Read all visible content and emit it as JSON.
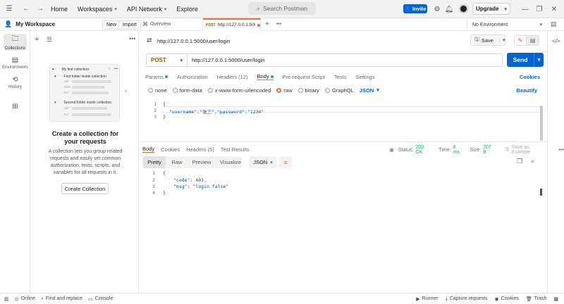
{
  "titlebar": {
    "home": "Home",
    "workspaces": "Workspaces",
    "api_network": "API Network",
    "explore": "Explore",
    "search_placeholder": "Search Postman",
    "invite": "Invite",
    "upgrade": "Upgrade"
  },
  "sidebar": {
    "workspace_name": "My Workspace",
    "new_label": "New",
    "import_label": "Import",
    "rail": [
      "Collections",
      "Environments",
      "History"
    ],
    "illustration": {
      "root": "My first collection",
      "folder1": "First folder inside collection",
      "folder2": "Second folder inside collection",
      "methods": [
        "GET",
        "POST",
        "PUT",
        "GET",
        "PUT"
      ]
    },
    "empty_title": "Create a collection for your requests",
    "empty_desc": "A collection lets you group related requests and easily set common authorization, tests, scripts, and variables for all requests in it.",
    "create_button": "Create Collection"
  },
  "tabs": {
    "overview": "Overview",
    "active_method": "POST",
    "active_url": "http://127.0.0.1:5000/u",
    "environment": "No Environment"
  },
  "request": {
    "title": "http://127.0.0.1:5000/user/login",
    "save": "Save",
    "method": "POST",
    "url": "http://127.0.0.1:5000/user/login",
    "send": "Send",
    "tabs": [
      "Params",
      "Authorization",
      "Headers (12)",
      "Body",
      "Pre-request Script",
      "Tests",
      "Settings"
    ],
    "cookies": "Cookies",
    "body_options": [
      "none",
      "form-data",
      "x-www-form-urlencoded",
      "raw",
      "binary",
      "GraphQL"
    ],
    "format": "JSON",
    "beautify": "Beautify",
    "code_lines": [
      "{",
      "\"username\":\"张三\",\"password\":\"1234\"",
      "}"
    ],
    "line_numbers": [
      "1",
      "2",
      "3"
    ]
  },
  "response": {
    "tabs": [
      "Body",
      "Cookies",
      "Headers (5)",
      "Test Results"
    ],
    "status_label": "Status:",
    "status_value": "200 OK",
    "time_label": "Time:",
    "time_value": "8 ms",
    "size_label": "Size:",
    "size_value": "207 B",
    "save_example": "Save as Example",
    "views": [
      "Pretty",
      "Raw",
      "Preview",
      "Visualize"
    ],
    "format": "JSON",
    "code_lines": [
      "{",
      "\"code\": 401,",
      "\"msg\": \"login false\"",
      "}"
    ],
    "line_numbers": [
      "1",
      "2",
      "3",
      "4"
    ]
  },
  "statusbar": {
    "online": "Online",
    "find_replace": "Find and replace",
    "console": "Console",
    "runner": "Runner",
    "capture": "Capture requests",
    "cookies": "Cookies",
    "trash": "Trash"
  },
  "colors": {
    "accent_blue": "#0265d2",
    "post_orange": "#a05a00",
    "body_radio": "#f26b3a",
    "status_green": "#0cbb52"
  }
}
